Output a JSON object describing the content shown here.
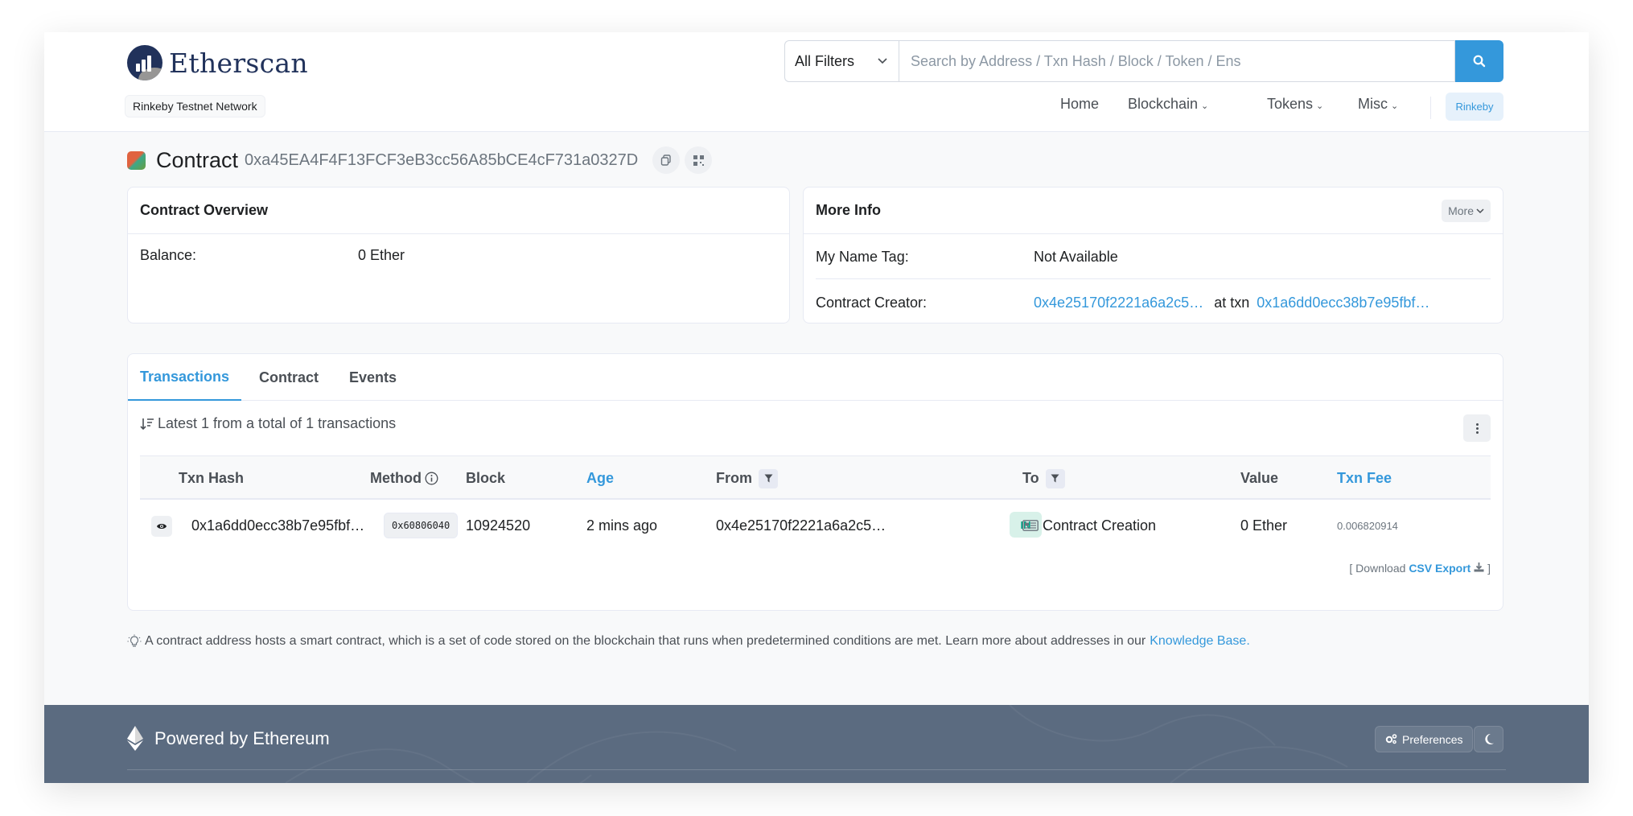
{
  "header": {
    "logo_text": "Etherscan",
    "network": "Rinkeby Testnet Network",
    "search": {
      "filter": "All Filters",
      "placeholder": "Search by Address / Txn Hash / Block / Token / Ens"
    },
    "nav": {
      "home": "Home",
      "blockchain": "Blockchain",
      "tokens": "Tokens",
      "misc": "Misc",
      "network_btn": "Rinkeby"
    }
  },
  "title": {
    "label": "Contract",
    "address": "0xa45EA4F4F13FCF3eB3cc56A85bCE4cF731a0327D"
  },
  "overview": {
    "heading": "Contract Overview",
    "balance_label": "Balance:",
    "balance_value": "0 Ether"
  },
  "more_info": {
    "heading": "More Info",
    "more_btn": "More",
    "name_tag_label": "My Name Tag:",
    "name_tag_value": "Not Available",
    "creator_label": "Contract Creator:",
    "creator_address": "0x4e25170f2221a6a2c5…",
    "at_txn": "at txn",
    "creator_txn": "0x1a6dd0ecc38b7e95fbf…"
  },
  "tabs": {
    "transactions": "Transactions",
    "contract": "Contract",
    "events": "Events"
  },
  "summary": "Latest 1 from a total of 1 transactions",
  "table": {
    "headers": {
      "txn_hash": "Txn Hash",
      "method": "Method",
      "block": "Block",
      "age": "Age",
      "from": "From",
      "to": "To",
      "value": "Value",
      "txn_fee": "Txn Fee"
    },
    "rows": [
      {
        "txn_hash": "0x1a6dd0ecc38b7e95fbf…",
        "method": "0x60806040",
        "block": "10924520",
        "age": "2 mins ago",
        "from": "0x4e25170f2221a6a2c5…",
        "direction": "IN",
        "to": "Contract Creation",
        "value": "0 Ether",
        "txn_fee": "0.006820914"
      }
    ]
  },
  "csv": {
    "prefix": "[ Download",
    "link": "CSV Export",
    "suffix": "]"
  },
  "note": {
    "text": "A contract address hosts a smart contract, which is a set of code stored on the blockchain that runs when predetermined conditions are met. Learn more about addresses in our",
    "link": "Knowledge Base."
  },
  "footer": {
    "powered": "Powered by Ethereum",
    "preferences": "Preferences"
  },
  "colors": {
    "accent": "#3498db",
    "brand": "#21325b",
    "footer": "#5b6b80",
    "in_badge": "#00a186"
  },
  "icons": [
    "search-icon",
    "chevron-down-icon",
    "copy-icon",
    "qr-code-icon",
    "sort-icon",
    "info-icon",
    "filter-icon",
    "eye-icon",
    "contract-icon",
    "download-icon",
    "lightbulb-icon",
    "ethereum-icon",
    "gears-icon",
    "moon-icon",
    "kebab-icon"
  ]
}
